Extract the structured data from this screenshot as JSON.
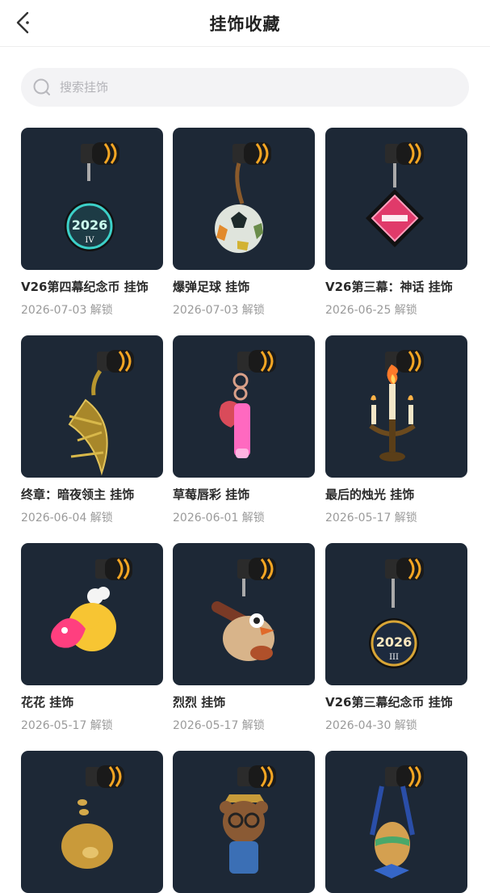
{
  "header": {
    "title": "挂饰收藏",
    "back_icon": "back-arrow-icon"
  },
  "search": {
    "placeholder": "搜索挂饰",
    "value": "",
    "icon": "search-icon"
  },
  "colors": {
    "card_bg": "#1d2836",
    "clip_accent": "#f5a623"
  },
  "items": [
    {
      "name": "V26第四幕纪念币 挂饰",
      "date": "2026-07-03 解锁",
      "charm": "coin-2026-iv"
    },
    {
      "name": "爆弹足球 挂饰",
      "date": "2026-07-03 解锁",
      "charm": "soccer-ball"
    },
    {
      "name": "V26第三幕：神话 挂饰",
      "date": "2026-06-25 解锁",
      "charm": "pink-diamond"
    },
    {
      "name": "终章：暗夜领主 挂饰",
      "date": "2026-06-04 解锁",
      "charm": "golden-crescent"
    },
    {
      "name": "草莓唇彩 挂饰",
      "date": "2026-06-01 解锁",
      "charm": "strawberry-lipgloss"
    },
    {
      "name": "最后的烛光 挂饰",
      "date": "2026-05-17 解锁",
      "charm": "candelabra"
    },
    {
      "name": "花花 挂饰",
      "date": "2026-05-17 解锁",
      "charm": "pink-duck"
    },
    {
      "name": "烈烈 挂饰",
      "date": "2026-05-17 解锁",
      "charm": "bird-chef"
    },
    {
      "name": "V26第三幕纪念币 挂饰",
      "date": "2026-04-30 解锁",
      "charm": "coin-2026-iii"
    },
    {
      "name": "",
      "date": "",
      "charm": "golden-pig"
    },
    {
      "name": "",
      "date": "",
      "charm": "bear-glasses"
    },
    {
      "name": "",
      "date": "",
      "charm": "easter-egg-bow"
    }
  ]
}
